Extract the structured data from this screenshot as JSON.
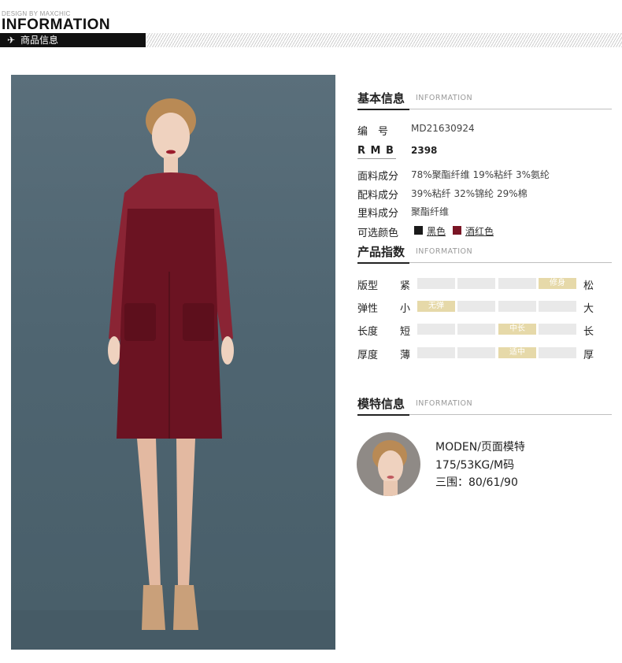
{
  "header": {
    "brand_line": "DESIGN BY MAXCHIC",
    "title": "INFORMATION",
    "bar_label": "商品信息"
  },
  "basic": {
    "title": "基本信息",
    "subtitle": "INFORMATION",
    "code_label": "编　号",
    "code_value": "MD21630924",
    "price_label": "R M B",
    "price_value": "2398",
    "fabric_label": "面料成分",
    "fabric_value": "78%聚酯纤维 19%粘纤 3%氨纶",
    "trim_label": "配料成分",
    "trim_value": "39%粘纤 32%锦纶 29%棉",
    "lining_label": "里料成分",
    "lining_value": "聚酯纤维",
    "colors_label": "可选颜色",
    "colors": [
      {
        "name": "黑色",
        "hex": "#1a1a1a"
      },
      {
        "name": "酒红色",
        "hex": "#7a1525"
      }
    ]
  },
  "index": {
    "title": "产品指数",
    "subtitle": "INFORMATION",
    "rows": [
      {
        "label": "版型",
        "left": "紧",
        "right": "松",
        "selected": 4,
        "selected_label": "修身"
      },
      {
        "label": "弹性",
        "left": "小",
        "right": "大",
        "selected": 1,
        "selected_label": "无弹"
      },
      {
        "label": "长度",
        "left": "短",
        "right": "长",
        "selected": 3,
        "selected_label": "中长"
      },
      {
        "label": "厚度",
        "left": "薄",
        "right": "厚",
        "selected": 3,
        "selected_label": "适中"
      }
    ]
  },
  "model": {
    "title": "模特信息",
    "subtitle": "INFORMATION",
    "line1": "MODEN/页面模特",
    "line2": "175/53KG/M码",
    "line3": "三围：80/61/90"
  },
  "colors": {
    "accent_selected": "#e6d9a9",
    "bar_empty": "#e9e9e9",
    "photo_bg": "#51656f",
    "dress": "#6b1322"
  }
}
